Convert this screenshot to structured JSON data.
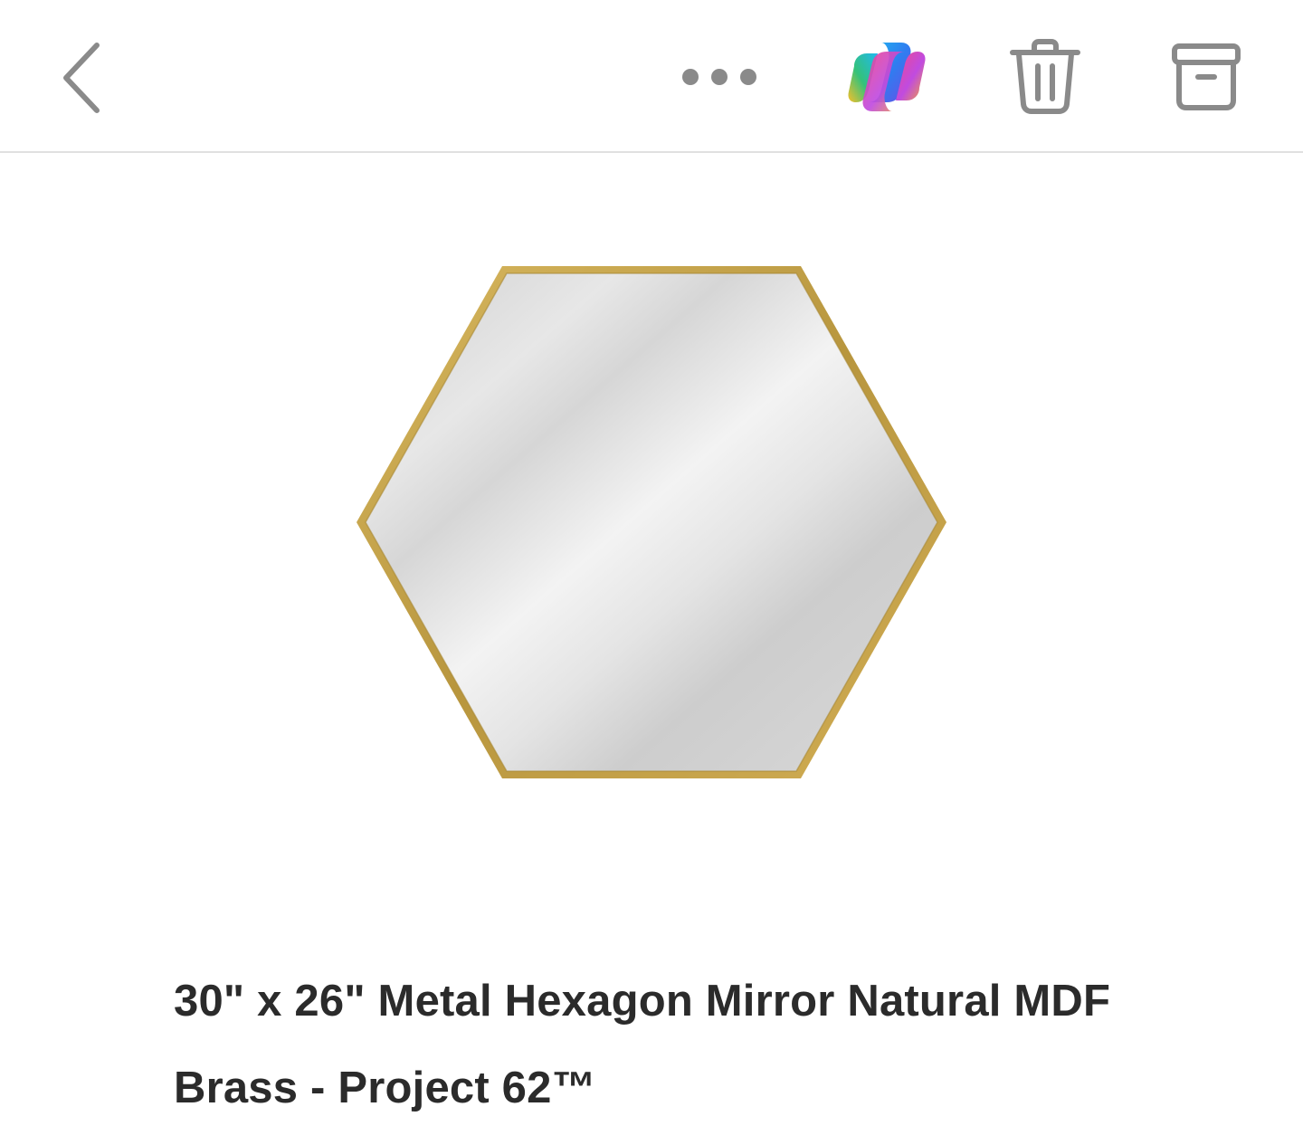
{
  "toolbar": {
    "back": {
      "icon": "chevron-left-icon"
    },
    "more": {
      "icon": "more-horizontal-icon"
    },
    "copilot": {
      "icon": "copilot-icon"
    },
    "delete": {
      "icon": "trash-icon"
    },
    "archive": {
      "icon": "archive-icon"
    },
    "icon_color": "#8a8a8a"
  },
  "product": {
    "image": {
      "icon": "hexagon-mirror-image",
      "frame_color": "#c9a74e"
    },
    "title": "30\" x 26\" Metal Hexagon Mirror Natural MDF Brass - Project 62™"
  }
}
